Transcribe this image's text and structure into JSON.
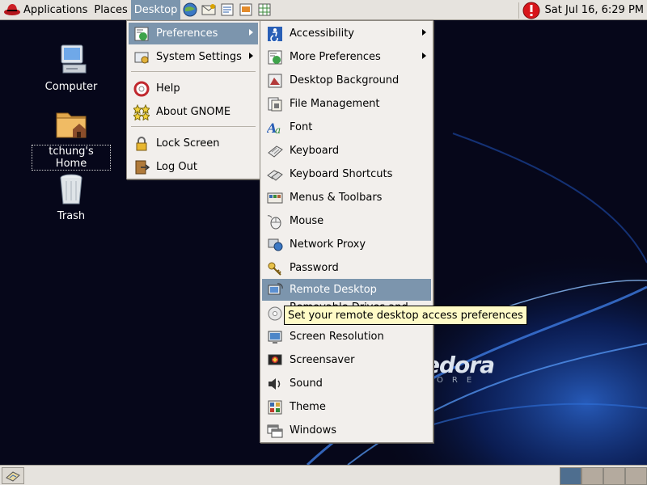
{
  "colors": {
    "panel_bg": "#e6e3de",
    "menu_bg": "#f2efec",
    "highlight": "#7c95ad",
    "tooltip_bg": "#fffbc7",
    "desktop_bg": "#05060f"
  },
  "top_panel": {
    "menus": [
      {
        "label": "Applications",
        "icon": "redhat-icon"
      },
      {
        "label": "Places"
      },
      {
        "label": "Desktop",
        "active": true
      }
    ],
    "launchers": [
      "web-browser-icon",
      "email-icon",
      "writer-icon",
      "presentation-icon",
      "spreadsheet-icon"
    ],
    "clock": "Sat Jul 16,  6:29 PM",
    "alert_icon": "update-alert-icon"
  },
  "desktop_icons": [
    {
      "label": "Computer",
      "icon": "computer-icon"
    },
    {
      "label": "tchung's Home",
      "icon": "home-folder-icon",
      "selected": true
    },
    {
      "label": "Trash",
      "icon": "trash-icon"
    }
  ],
  "desktop_menu": {
    "items": [
      {
        "label": "Preferences",
        "icon": "preferences-icon",
        "submenu": true,
        "highlighted": true
      },
      {
        "label": "System Settings",
        "icon": "system-settings-icon",
        "submenu": true
      },
      {
        "label": "Help",
        "icon": "help-icon"
      },
      {
        "label": "About GNOME",
        "icon": "about-gnome-icon"
      },
      {
        "label": "Lock Screen",
        "icon": "lock-icon"
      },
      {
        "label": "Log Out",
        "icon": "logout-icon"
      }
    ]
  },
  "preferences_menu": {
    "items": [
      {
        "label": "Accessibility",
        "icon": "accessibility-icon",
        "submenu": true
      },
      {
        "label": "More Preferences",
        "icon": "preferences-icon",
        "submenu": true
      },
      {
        "label": "Desktop Background",
        "icon": "desktop-background-icon"
      },
      {
        "label": "File Management",
        "icon": "file-management-icon"
      },
      {
        "label": "Font",
        "icon": "font-icon"
      },
      {
        "label": "Keyboard",
        "icon": "keyboard-icon"
      },
      {
        "label": "Keyboard Shortcuts",
        "icon": "keyboard-shortcuts-icon"
      },
      {
        "label": "Menus & Toolbars",
        "icon": "menus-toolbars-icon"
      },
      {
        "label": "Mouse",
        "icon": "mouse-icon"
      },
      {
        "label": "Network Proxy",
        "icon": "network-proxy-icon"
      },
      {
        "label": "Password",
        "icon": "password-icon"
      },
      {
        "label": "Remote Desktop",
        "icon": "remote-desktop-icon",
        "highlighted": true
      },
      {
        "label": "Removable Drives and Media",
        "icon": "removable-media-icon"
      },
      {
        "label": "Screen Resolution",
        "icon": "screen-resolution-icon"
      },
      {
        "label": "Screensaver",
        "icon": "screensaver-icon"
      },
      {
        "label": "Sound",
        "icon": "sound-icon"
      },
      {
        "label": "Theme",
        "icon": "theme-icon"
      },
      {
        "label": "Windows",
        "icon": "windows-icon"
      }
    ]
  },
  "tooltip": {
    "text": "Set your remote desktop access preferences"
  },
  "wallpaper": {
    "brand": "edora",
    "sub": "ORE"
  },
  "bottom_panel": {
    "show_desktop_icon": "show-desktop-icon",
    "workspaces": [
      {
        "name": "workspace-1",
        "active": true
      },
      {
        "name": "workspace-2",
        "active": false
      },
      {
        "name": "workspace-3",
        "active": false
      },
      {
        "name": "workspace-4",
        "active": false
      }
    ]
  }
}
